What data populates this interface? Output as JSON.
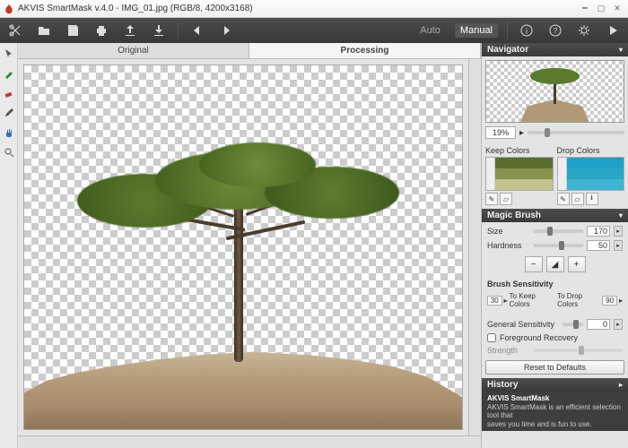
{
  "window": {
    "title": "AKVIS SmartMask v.4.0 - IMG_01.jpg (RGB/8, 4200x3168)"
  },
  "modes": {
    "auto": "Auto",
    "manual": "Manual"
  },
  "tabs": {
    "original": "Original",
    "processing": "Processing"
  },
  "navigator": {
    "header": "Navigator",
    "zoom": "19%"
  },
  "colors": {
    "keep": "Keep Colors",
    "drop": "Drop Colors"
  },
  "magicbrush": {
    "header": "Magic Brush",
    "size_label": "Size",
    "size_value": "170",
    "hardness_label": "Hardness",
    "hardness_value": "50",
    "sensitivity_label": "Brush Sensitivity",
    "to_keep_val": "30",
    "to_keep_label": "To  Keep Colors",
    "to_drop_label": "To Drop Colors",
    "to_drop_val": "90",
    "general_label": "General Sensitivity",
    "general_value": "0",
    "fg_recovery": "Foreground Recovery",
    "strength_label": "Strength",
    "reset": "Reset to Defaults"
  },
  "history": {
    "header": "History"
  },
  "footer": {
    "product": "AKVIS SmartMask",
    "line1": "AKVIS SmartMask is an efficient selection tool that",
    "line2": "saves you time and is fun to use."
  },
  "swatches": {
    "keep": [
      "#5a6e32",
      "#88954e",
      "#c3c18f"
    ],
    "drop": [
      "#1fa0c8",
      "#2aa6c5",
      "#3fb4d2"
    ]
  }
}
